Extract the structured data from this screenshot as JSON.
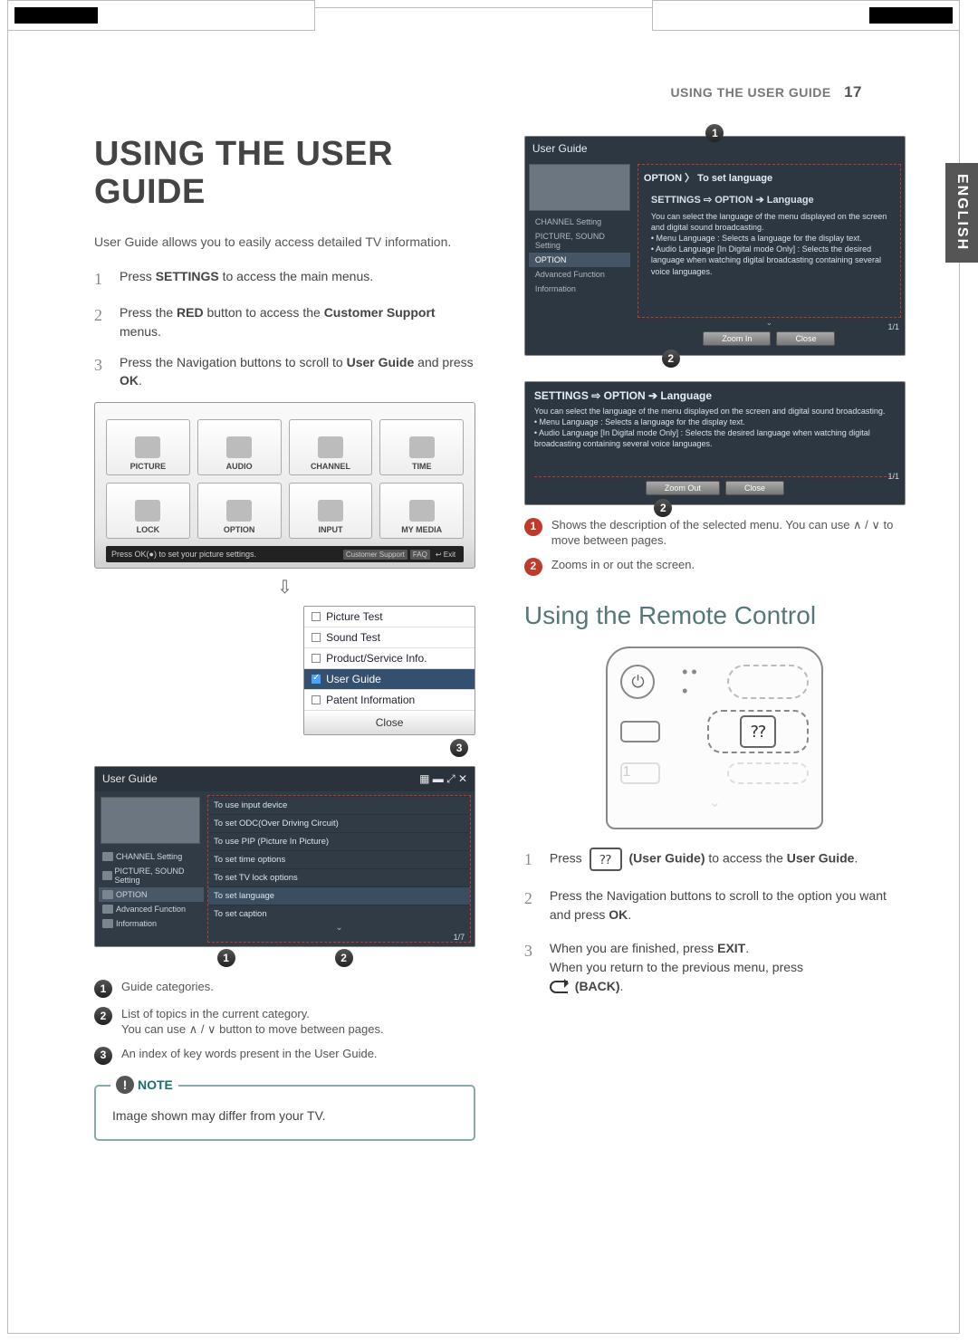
{
  "header": {
    "section": "USING THE USER GUIDE",
    "page": "17"
  },
  "lang_tab": "ENGLISH",
  "h1": "USING THE USER GUIDE",
  "intro": "User Guide allows you to easily access detailed TV information.",
  "steps": {
    "s1_a": "Press ",
    "s1_b": "SETTINGS",
    "s1_c": " to access the main menus.",
    "s2_a": "Press the ",
    "s2_b": "RED",
    "s2_c": " button to access the ",
    "s2_d": "Customer Support",
    "s2_e": " menus.",
    "s3_a": "Press the Navigation buttons to scroll to ",
    "s3_b": "User Guide",
    "s3_c": " and press ",
    "s3_d": "OK",
    "s3_e": "."
  },
  "tvgrid": [
    "PICTURE",
    "AUDIO",
    "CHANNEL",
    "TIME",
    "LOCK",
    "OPTION",
    "INPUT",
    "MY MEDIA"
  ],
  "tvfoot": {
    "tip": "Press OK(●) to set your picture settings.",
    "cs": "Customer Support",
    "faq": "FAQ",
    "exit": "↩ Exit"
  },
  "submenu": {
    "items": [
      "Picture Test",
      "Sound Test",
      "Product/Service Info.",
      "User Guide",
      "Patent Information"
    ],
    "close": "Close"
  },
  "guide_panel": {
    "title": "User Guide",
    "side": [
      "CHANNEL Setting",
      "PICTURE, SOUND Setting",
      "OPTION",
      "Advanced Function",
      "Information"
    ],
    "main_hdr": "",
    "main": [
      "To use input device",
      "To set ODC(Over Driving Circuit)",
      "To use PIP (Picture In Picture)",
      "To set time options",
      "To set TV lock options",
      "To set language",
      "To set caption"
    ],
    "page": "1/7",
    "close": "Close"
  },
  "legend_left": {
    "l1": "Guide categories.",
    "l2a": "List of topics in the current category.",
    "l2b": "You can use ∧ / ∨ button to move between pages.",
    "l3": "An index of key words present in the User Guide."
  },
  "note": {
    "label": "NOTE",
    "text": "Image shown may differ from your TV."
  },
  "scr1": {
    "title": "User Guide",
    "side": [
      "CHANNEL Setting",
      "PICTURE, SOUND Setting",
      "OPTION",
      "Advanced Function",
      "Information"
    ],
    "hdr": "OPTION 〉 To set language",
    "lead": "SETTINGS ⇨ OPTION ➔ Language",
    "body1": "You can select the language of the menu displayed on the screen and digital sound broadcasting.",
    "body2": "• Menu Language : Selects a language for the display text.",
    "body3": "• Audio Language [In Digital mode Only] : Selects the desired language when watching digital broadcasting containing several voice languages.",
    "zoom": "Zoom In",
    "close": "Close",
    "pg": "1/1"
  },
  "scr2": {
    "lead": "SETTINGS ⇨ OPTION ➔ Language",
    "body1": "You can select the language of the menu displayed on the screen and digital sound broadcasting.",
    "body2": "• Menu Language : Selects a language for the display text.",
    "body3": "• Audio Language [In Digital mode Only] : Selects the desired language when watching digital broadcasting containing several voice languages.",
    "zoom": "Zoom Out",
    "close": "Close",
    "pg": "1/1"
  },
  "legend_right": {
    "l1": "Shows the description of the selected menu. You can use ∧ / ∨ to move between pages.",
    "l2": "Zooms in or out the screen."
  },
  "h2": "Using the Remote Control",
  "rsteps": {
    "s1_a": "Press ",
    "s1_b": " (User Guide)",
    "s1_c": " to access the ",
    "s1_d": "User Guide",
    "s1_e": ".",
    "s2_a": "Press the Navigation buttons to scroll to the option you want and press ",
    "s2_b": "OK",
    "s2_c": ".",
    "s3_a": "When you are finished, press ",
    "s3_b": "EXIT",
    "s3_c": ".",
    "s3_d": "When you return to the previous menu, press ",
    "s3_e": " (BACK)",
    "s3_f": "."
  }
}
